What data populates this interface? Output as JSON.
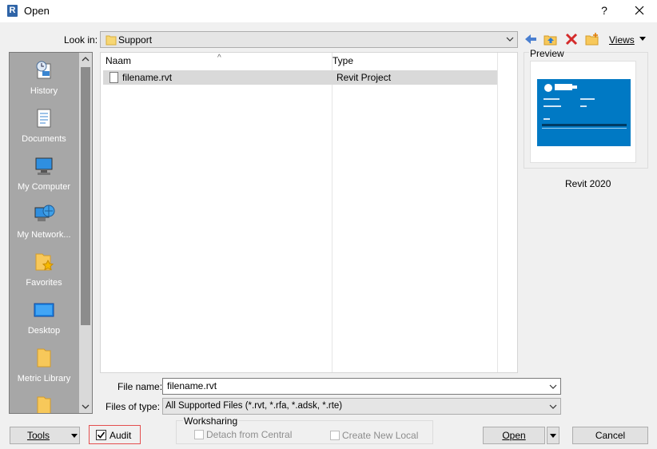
{
  "window": {
    "title": "Open",
    "help": "?",
    "app_icon_letter": "R"
  },
  "lookin": {
    "label": "Look in:",
    "value": "Support"
  },
  "toolbar": {
    "views_label": "Views",
    "icons": [
      "back-arrow-icon",
      "up-folder-icon",
      "delete-icon",
      "new-folder-icon",
      "views-dropdown-icon"
    ]
  },
  "places": [
    {
      "label": "History",
      "icon": "history-icon"
    },
    {
      "label": "Documents",
      "icon": "documents-icon"
    },
    {
      "label": "My Computer",
      "icon": "computer-icon"
    },
    {
      "label": "My Network...",
      "icon": "network-icon"
    },
    {
      "label": "Favorites",
      "icon": "favorites-icon"
    },
    {
      "label": "Desktop",
      "icon": "desktop-icon"
    },
    {
      "label": "Metric Library",
      "icon": "folder-icon"
    }
  ],
  "filelist": {
    "columns": [
      "Naam",
      "Type"
    ],
    "rows": [
      {
        "name": "filename.rvt",
        "type": "Revit Project"
      }
    ]
  },
  "preview": {
    "label": "Preview",
    "version": "Revit 2020"
  },
  "form": {
    "filename_label": "File name:",
    "filename_value": "filename.rvt",
    "filetype_label": "Files of type:",
    "filetype_value": "All Supported Files  (*.rvt, *.rfa, *.adsk, *.rte)"
  },
  "footer": {
    "tools": "Tools",
    "audit": "Audit",
    "worksharing": "Worksharing",
    "detach": "Detach from Central",
    "create_local": "Create New Local",
    "open": "Open",
    "cancel": "Cancel"
  },
  "colors": {
    "accent": "#0077c8",
    "audit_highlight": "#e34f4f"
  }
}
